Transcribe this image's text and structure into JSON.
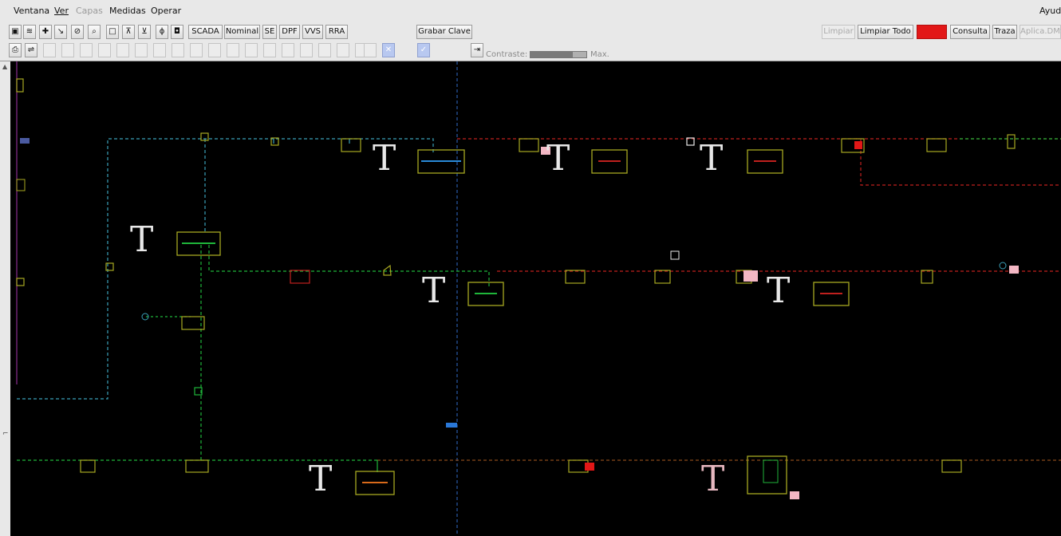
{
  "menubar": {
    "items": [
      "Ventana",
      "Ver",
      "Capas",
      "Medidas",
      "Operar"
    ],
    "help": "Ayuda"
  },
  "toolbar": {
    "scada": "SCADA",
    "nominal": "Nominal",
    "se": "SE",
    "dpf": "DPF",
    "vvs": "VVS",
    "rra": "RRA",
    "grabar_clave": "Grabar Clave",
    "contraste_label": "Contraste:",
    "contraste_max": "Max.",
    "contraste_level": 0.75,
    "limpiar": "Limpiar",
    "limpiar_todo": "Limpiar Todo",
    "alarma_color": "#e21717",
    "consulta": "Consulta",
    "traza": "Traza",
    "aplica": "Aplica.DMS"
  },
  "diagram": {
    "transformer_glyph": "T",
    "colors": {
      "background": "#000000",
      "feeder_cyan": "#3aa0b8",
      "feeder_green": "#1fb53a",
      "feeder_red": "#c0201e",
      "feeder_brown": "#8a4a1a",
      "frame_olive": "#a7a821",
      "tap_pink": "#f3b7c4",
      "boundary_magenta": "#8a2d8f",
      "divider_blue": "#2a5aa8",
      "glyph_white": "#e8e8e8",
      "glyph_pink": "#e7b8c0"
    }
  }
}
